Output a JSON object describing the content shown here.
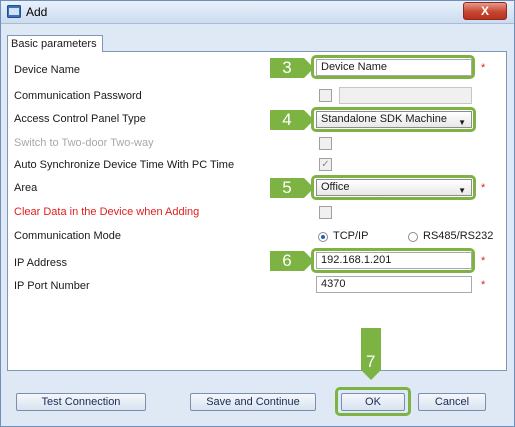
{
  "window": {
    "title": "Add",
    "close_label": "X"
  },
  "tab": {
    "label": "Basic parameters"
  },
  "fields": {
    "device_name": {
      "label": "Device Name",
      "value": "Device Name"
    },
    "comm_password": {
      "label": "Communication Password",
      "value": ""
    },
    "panel_type": {
      "label": "Access Control Panel Type",
      "value": "Standalone SDK Machine"
    },
    "two_door": {
      "label": "Switch to Two-door Two-way"
    },
    "auto_sync": {
      "label": "Auto Synchronize Device Time With PC Time"
    },
    "area": {
      "label": "Area",
      "value": "Office"
    },
    "clear_data": {
      "label": "Clear Data in the Device when Adding"
    },
    "comm_mode": {
      "label": "Communication Mode",
      "option_tcp": "TCP/IP",
      "option_rs": "RS485/RS232"
    },
    "ip_address": {
      "label": "IP Address",
      "value": "192.168.1.201"
    },
    "ip_port": {
      "label": "IP Port Number",
      "value": "4370"
    }
  },
  "required_mark": "*",
  "steps": {
    "s3": "3",
    "s4": "4",
    "s5": "5",
    "s6": "6",
    "s7": "7"
  },
  "buttons": {
    "test": "Test Connection",
    "save_continue": "Save and Continue",
    "ok": "OK",
    "cancel": "Cancel"
  },
  "checkmark": "✓",
  "colors": {
    "highlight": "#7cb342",
    "required": "#e02020",
    "warning_label": "#e02020"
  }
}
